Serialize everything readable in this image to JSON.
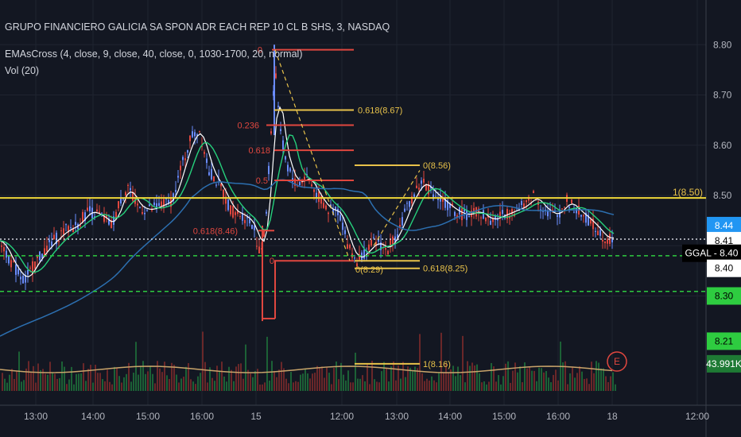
{
  "legend": {
    "symbol_line": "GRUPO FINANCIERO GALICIA SA SPON ADR EACH REP 10 CL B SHS, 3, NASDAQ",
    "ema_line": "EMAsCross (4, close, 9, close, 40, close, 0, 1030-1700, 20, normal)",
    "vol_line": "Vol (20)"
  },
  "colors": {
    "background": "#131722",
    "grid": "#1f2430",
    "text": "#b2b5be",
    "fib_red": "#e0473f",
    "fib_gold": "#e8c24a",
    "ema_fast": "#ffffff",
    "ema_mid": "#26d07c",
    "ema_slow": "#2c6fb0",
    "green_level": "#2ecc40",
    "resistance": "#f0d839"
  },
  "chart_data": {
    "type": "candlestick",
    "symbol": "GGAL",
    "ylim": [
      8.13,
      8.87
    ],
    "x_tick_labels": [
      "13:00",
      "14:00",
      "15:00",
      "16:00",
      "15",
      "12:00",
      "13:00",
      "14:00",
      "15:00",
      "16:00",
      "18",
      "12:00"
    ],
    "y_tick_labels": [
      "8.80",
      "8.70",
      "8.60",
      "8.50",
      "8.40",
      "8.30"
    ],
    "price_badges": [
      {
        "label": "8.44",
        "value": 8.44,
        "color": "#2196f3",
        "text_color": "#ffffff"
      },
      {
        "label": "8.41",
        "value": 8.41,
        "color": "#ffffff",
        "text_color": "#000000"
      },
      {
        "label": "GGAL - 8.40",
        "value": 8.385,
        "color": "#000000",
        "text_color": "#ffffff"
      },
      {
        "label": "8.40",
        "value": 8.355,
        "color": "#ffffff",
        "text_color": "#000000"
      },
      {
        "label": "8.30",
        "value": 8.3,
        "color": "#2ecc40",
        "text_color": "#000000"
      },
      {
        "label": "8.21",
        "value": 8.21,
        "color": "#2ecc40",
        "text_color": "#000000"
      },
      {
        "label": "43.991K",
        "value": 8.165,
        "color": "#1e7a34",
        "text_color": "#ffffff"
      }
    ],
    "levels": [
      {
        "kind": "resistance",
        "value": 8.495,
        "label": "1(8.50)"
      },
      {
        "kind": "dotted",
        "value": 8.413
      },
      {
        "kind": "green_dashed",
        "value": 8.38
      },
      {
        "kind": "green_dashed",
        "value": 8.309
      }
    ],
    "fib_labels_red": [
      "0",
      "0.236",
      "0.618",
      "0.5",
      "0",
      "0.618(8.46)"
    ],
    "fib_labels_gold": [
      "0.618(8.67)",
      "0(8.56)",
      "0(8.29)",
      "0.618(8.25)",
      "1(8.16)"
    ],
    "fib_red_values": [
      8.79,
      8.64,
      8.59,
      8.53,
      8.37,
      8.43
    ],
    "fib_gold_values": [
      8.67,
      8.56,
      8.37,
      8.355,
      8.165
    ],
    "ema_series": [
      "EMA 4",
      "EMA 9",
      "EMA 40"
    ],
    "close_path": [
      [
        0,
        8.41
      ],
      [
        15,
        8.36
      ],
      [
        30,
        8.33
      ],
      [
        45,
        8.37
      ],
      [
        60,
        8.4
      ],
      [
        80,
        8.43
      ],
      [
        95,
        8.44
      ],
      [
        110,
        8.47
      ],
      [
        125,
        8.46
      ],
      [
        140,
        8.44
      ],
      [
        150,
        8.49
      ],
      [
        160,
        8.52
      ],
      [
        170,
        8.48
      ],
      [
        185,
        8.47
      ],
      [
        200,
        8.48
      ],
      [
        215,
        8.49
      ],
      [
        230,
        8.57
      ],
      [
        240,
        8.62
      ],
      [
        250,
        8.63
      ],
      [
        262,
        8.55
      ],
      [
        275,
        8.52
      ],
      [
        290,
        8.47
      ],
      [
        305,
        8.46
      ],
      [
        318,
        8.44
      ],
      [
        326,
        8.38
      ],
      [
        333,
        8.44
      ],
      [
        340,
        8.63
      ],
      [
        345,
        8.76
      ],
      [
        352,
        8.62
      ],
      [
        360,
        8.56
      ],
      [
        372,
        8.52
      ],
      [
        385,
        8.54
      ],
      [
        398,
        8.5
      ],
      [
        412,
        8.47
      ],
      [
        425,
        8.47
      ],
      [
        437,
        8.4
      ],
      [
        447,
        8.37
      ],
      [
        460,
        8.39
      ],
      [
        472,
        8.41
      ],
      [
        485,
        8.39
      ],
      [
        500,
        8.43
      ],
      [
        515,
        8.49
      ],
      [
        530,
        8.53
      ],
      [
        540,
        8.51
      ],
      [
        555,
        8.49
      ],
      [
        570,
        8.47
      ],
      [
        585,
        8.46
      ],
      [
        600,
        8.47
      ],
      [
        615,
        8.45
      ],
      [
        630,
        8.46
      ],
      [
        645,
        8.47
      ],
      [
        660,
        8.48
      ],
      [
        670,
        8.5
      ],
      [
        685,
        8.47
      ],
      [
        700,
        8.46
      ],
      [
        712,
        8.49
      ],
      [
        725,
        8.47
      ],
      [
        740,
        8.45
      ],
      [
        752,
        8.43
      ],
      [
        762,
        8.41
      ],
      [
        770,
        8.42
      ]
    ],
    "volume_labels": [
      "E"
    ]
  }
}
